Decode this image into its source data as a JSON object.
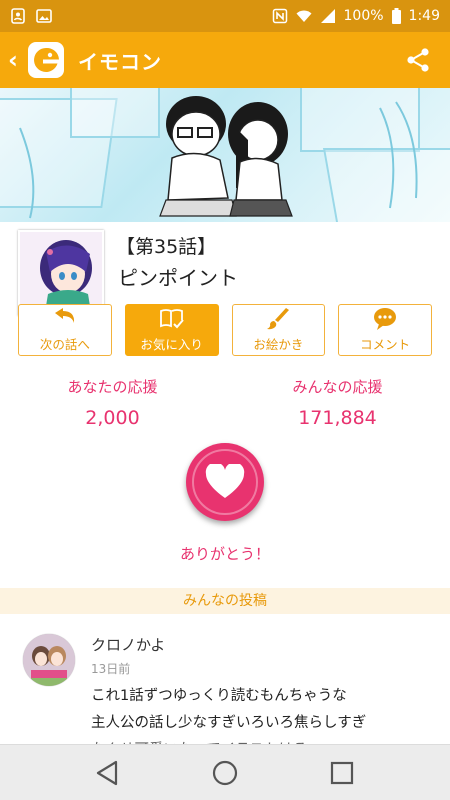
{
  "status_bar": {
    "battery": "100%",
    "time": "1:49"
  },
  "app_bar": {
    "title": "イモコン"
  },
  "episode": {
    "number": "【第35話】",
    "title": "ピンポイント"
  },
  "actions": [
    {
      "label": "次の話へ",
      "icon": "undo-arrow-icon"
    },
    {
      "label": "お気に入り",
      "icon": "book-check-icon",
      "active": true
    },
    {
      "label": "お絵かき",
      "icon": "brush-icon"
    },
    {
      "label": "コメント",
      "icon": "comment-icon"
    }
  ],
  "support": {
    "yours_label": "あなたの応援",
    "yours_value": "2,000",
    "everyone_label": "みんなの応援",
    "everyone_value": "171,884",
    "thanks": "ありがとう！"
  },
  "posts": {
    "header": "みんなの投稿",
    "items": [
      {
        "user": "クロノかよ",
        "time": "13日前",
        "lines": [
          "これ1話ずつゆっくり読むもんちゃうな",
          "主人公の話し少なすぎいろいろ焦らしすぎ",
          "なんせ可愛いなってイラストはる"
        ]
      }
    ]
  },
  "colors": {
    "status_bar": "#d9940f",
    "app_bar": "#f6a90c",
    "accent_pink": "#e8336f",
    "nav_bar": "#ececec"
  }
}
